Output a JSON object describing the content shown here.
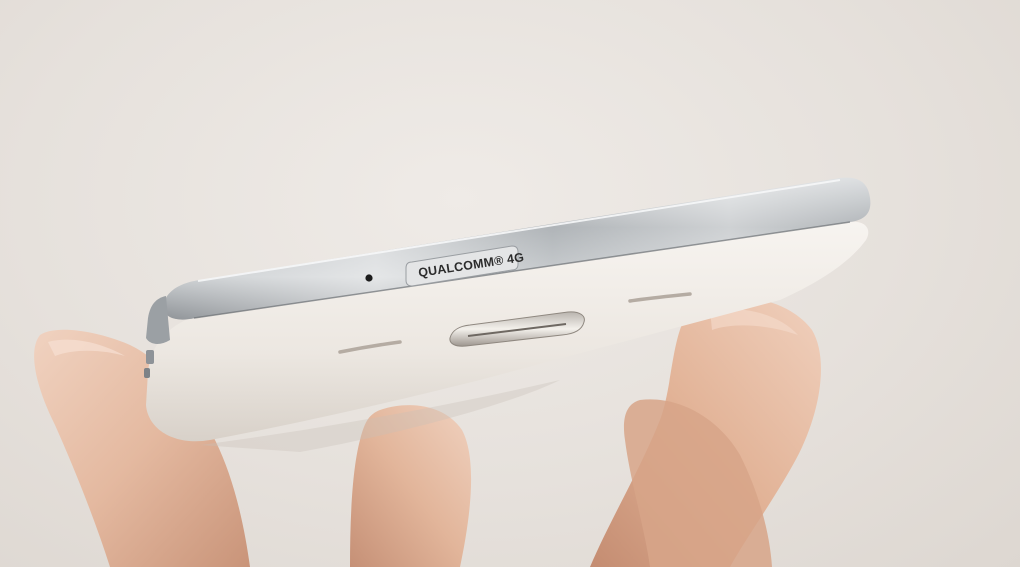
{
  "badge": {
    "text": "QUALCOMM® 4G"
  },
  "colors": {
    "background": "#e6e1dc",
    "phone_body": "#f1eee9",
    "metal_frame": "#9ea3a7",
    "skin": "#e2b9a1"
  }
}
